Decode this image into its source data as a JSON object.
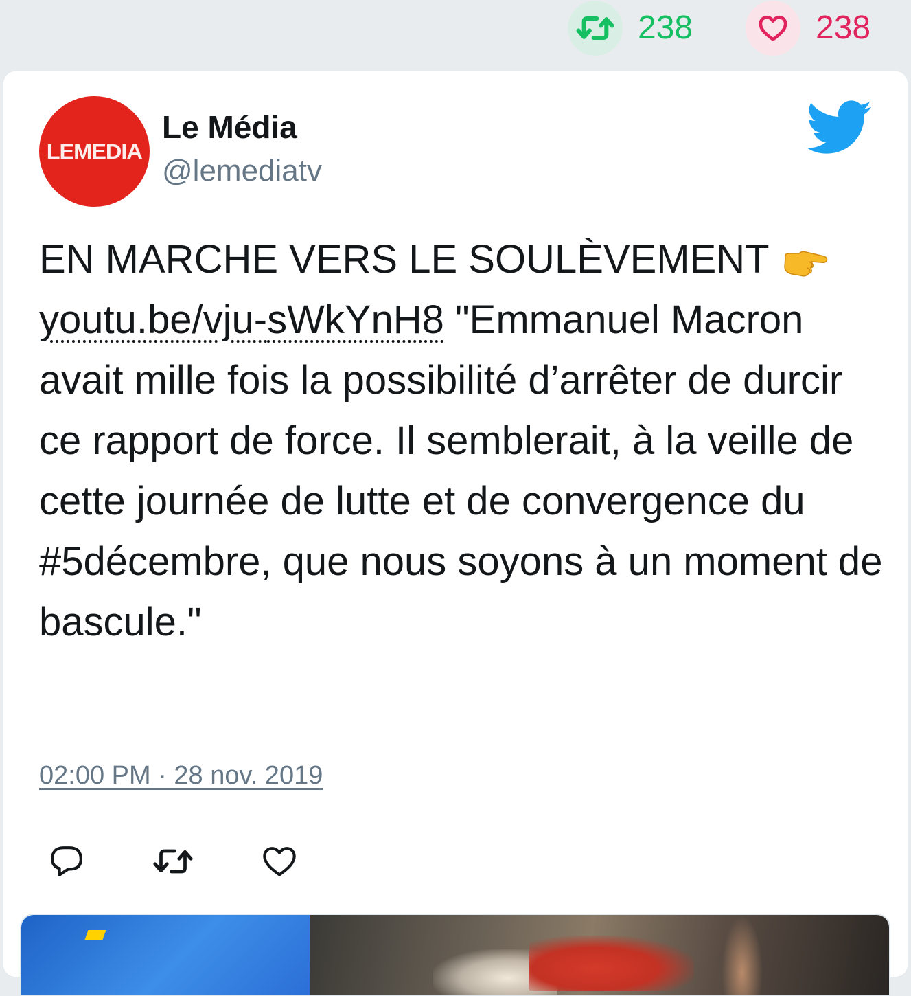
{
  "stats": {
    "retweets": "238",
    "likes": "238"
  },
  "tweet": {
    "author": {
      "name": "Le Média",
      "handle": "@lemediatv",
      "avatar_text": "LEMEDIA"
    },
    "text": {
      "part1": "EN MARCHE VERS LE SOULÈVEMENT",
      "emoji": "backhand-index-pointing-right",
      "link_a": "youtu.be/vju-",
      "link_b": "sWkYnH8",
      "part2": "\"Emmanuel Macron avait mille fois la possibilité d’arrêter de durcir ce rapport de force. Il semblerait, à la veille de cette journée de lutte et de convergence du #5décembre, que nous soyons à un moment de bascule.\""
    },
    "timestamp": "02:00 PM · 28 nov. 2019"
  },
  "colors": {
    "retweet_green": "#17bf63",
    "like_red": "#e0245e",
    "twitter_blue": "#1da1f2",
    "avatar_red": "#e2241d",
    "muted_gray": "#657786"
  },
  "icons": {
    "retweet": "retweet-icon",
    "like": "heart-icon",
    "reply": "reply-icon",
    "brand": "twitter-bird-icon"
  }
}
